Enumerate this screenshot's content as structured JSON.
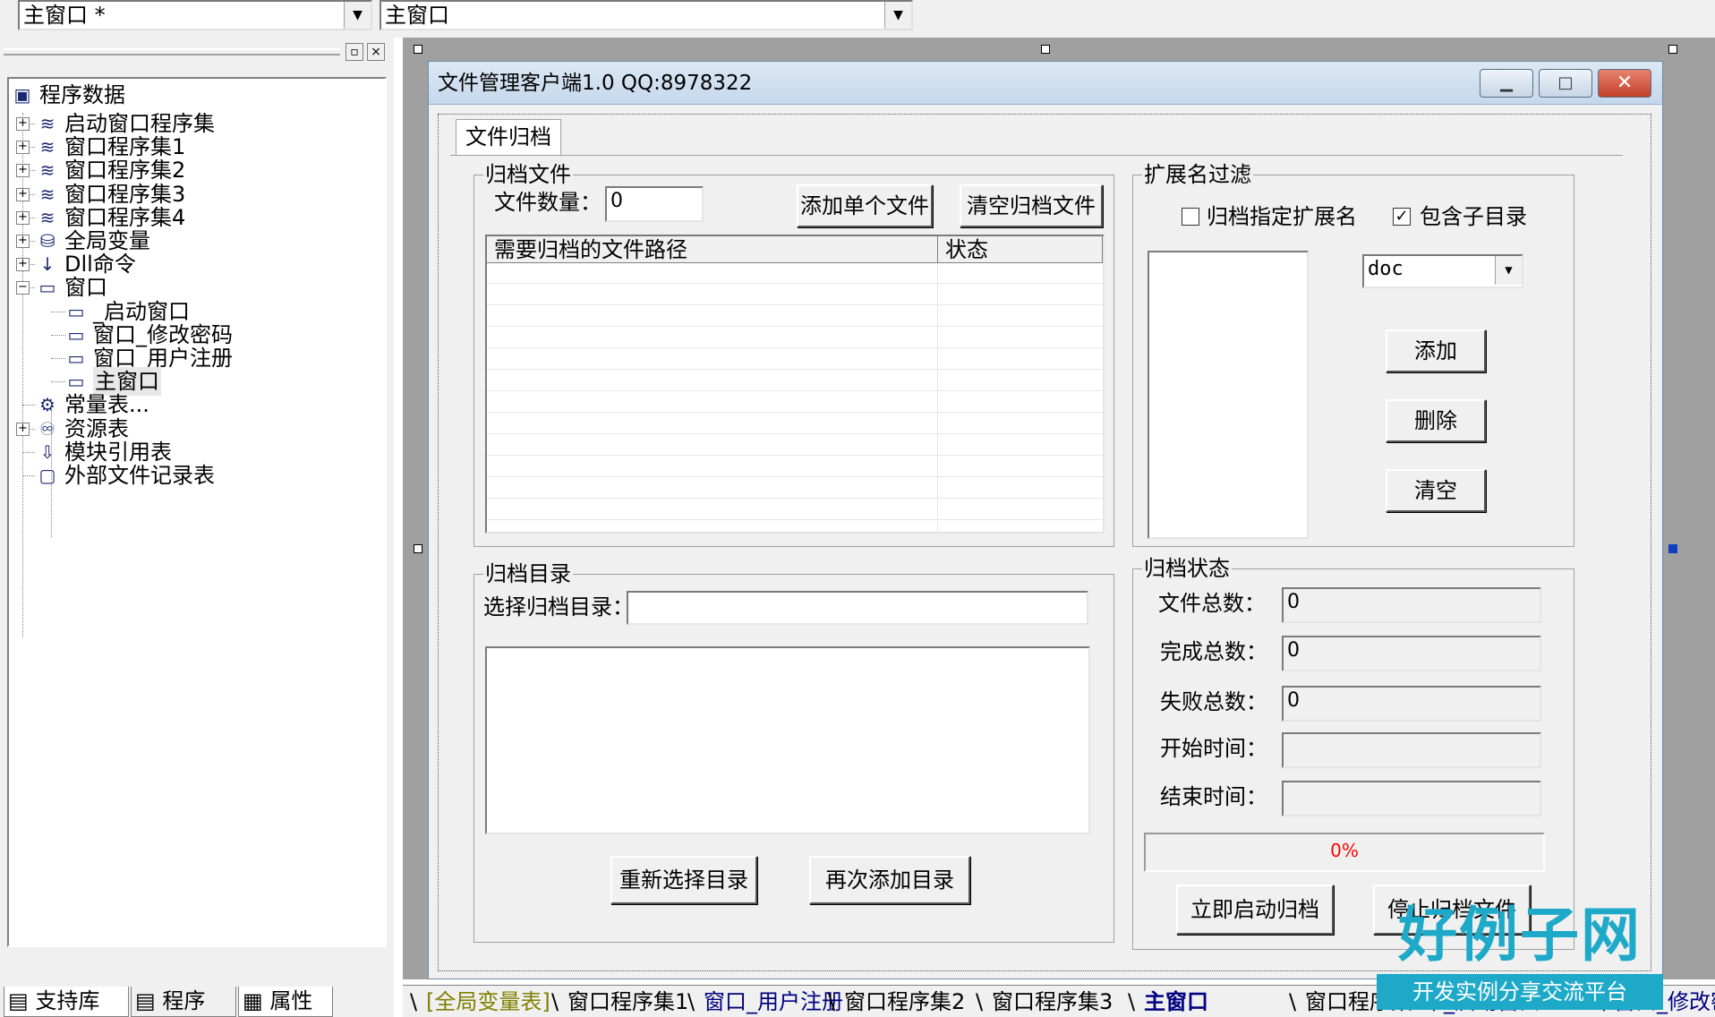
{
  "top": {
    "combo1": "主窗口 *",
    "combo2": "主窗口"
  },
  "tree": {
    "root": "程序数据",
    "items": [
      {
        "label": "启动窗口程序集",
        "icon": "module-icon"
      },
      {
        "label": "窗口程序集1",
        "icon": "module-icon"
      },
      {
        "label": "窗口程序集2",
        "icon": "module-icon"
      },
      {
        "label": "窗口程序集3",
        "icon": "module-icon"
      },
      {
        "label": "窗口程序集4",
        "icon": "module-icon"
      },
      {
        "label": "全局变量",
        "icon": "database-icon"
      },
      {
        "label": "Dll命令",
        "icon": "dll-icon"
      },
      {
        "label": "窗口",
        "icon": "window-icon"
      },
      {
        "label": "_启动窗口",
        "icon": "window-icon"
      },
      {
        "label": "窗口_修改密码",
        "icon": "window-icon"
      },
      {
        "label": "窗口_用户注册",
        "icon": "window-icon"
      },
      {
        "label": "主窗口",
        "icon": "window-icon"
      },
      {
        "label": "常量表...",
        "icon": "constants-icon"
      },
      {
        "label": "资源表",
        "icon": "resources-icon"
      },
      {
        "label": "模块引用表",
        "icon": "module-ref-icon"
      },
      {
        "label": "外部文件记录表",
        "icon": "external-file-icon"
      }
    ]
  },
  "left_tabs": [
    "支持库",
    "程序",
    "属性"
  ],
  "window": {
    "title": "文件管理客户端1.0   QQ:8978322",
    "tab": "文件归档",
    "archive_files": {
      "title": "归档文件",
      "count_label": "文件数量：",
      "count_value": "0",
      "add_single": "添加单个文件",
      "clear_files": "清空归档文件",
      "columns": [
        "需要归档的文件路径",
        "状态"
      ]
    },
    "ext_filter": {
      "title": "扩展名过滤",
      "archive_ext": "归档指定扩展名",
      "include_sub": "包含子目录",
      "include_sub_checked": true,
      "ext_value": "doc",
      "add": "添加",
      "delete": "删除",
      "clear": "清空"
    },
    "archive_dir": {
      "title": "归档目录",
      "select_label": "选择归档目录：",
      "reselect": "重新选择目录",
      "add_again": "再次添加目录"
    },
    "archive_status": {
      "title": "归档状态",
      "total_label": "文件总数：",
      "total_value": "0",
      "done_label": "完成总数：",
      "done_value": "0",
      "fail_label": "失败总数：",
      "fail_value": "0",
      "start_label": "开始时间：",
      "end_label": "结束时间：",
      "progress_text": "0%",
      "progress": 0,
      "start_btn": "立即启动归档",
      "stop_btn": "停止归档文件"
    }
  },
  "bottom_tabs": [
    "[全局变量表]",
    "窗口程序集1",
    "窗口_用户注册",
    "窗口程序集2",
    "窗口程序集3",
    "主窗口",
    "窗口程序集",
    "_启动窗口",
    "窗口_修改密"
  ],
  "logo": {
    "main": "好例子网",
    "sub": "开发实例分享交流平台"
  },
  "colors": {
    "accent": "#1ea9c9",
    "link_tab": "#000080",
    "global_tab": "#808000",
    "progress_text": "#ff0000"
  }
}
